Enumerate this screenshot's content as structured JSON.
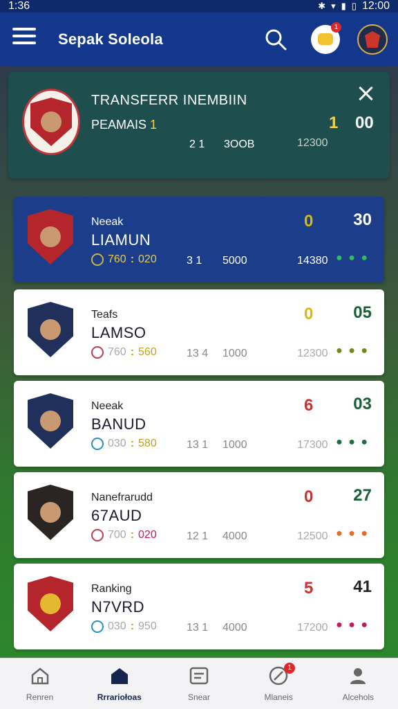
{
  "status_bar": {
    "time": "1:36",
    "time_right": "12:00"
  },
  "header": {
    "title": "Sepak Soleola"
  },
  "badges": {
    "chat_count": "1",
    "nav_badge": "1"
  },
  "featured": {
    "title": "TRANSFERR INEMBIIN",
    "subtitle_label": "PEAMAIS",
    "subtitle_num": "1",
    "meta_a": "2 1",
    "meta_b": "3OOB",
    "num_left": "1",
    "num_right": "00",
    "num_meta": "12300"
  },
  "cards": [
    {
      "kicker": "Neeak",
      "name": "LIAMUN",
      "stat_left": "760",
      "stat_sep": ":",
      "stat_right": "020",
      "mid_a": "3 1",
      "mid_b": "5000",
      "pin": "0",
      "pin_color": "yellow",
      "score": "30",
      "sub": "14380",
      "dots": "● ● ●",
      "dots_color": "#1b8e4a"
    },
    {
      "kicker": "Teafs",
      "name": "LAMSO",
      "stat_left": "760",
      "stat_sep": ":",
      "stat_right": "560",
      "mid_a": "13 4",
      "mid_b": "1000",
      "pin": "0",
      "pin_color": "yellow",
      "score": "05",
      "sub": "12300",
      "dots": "● ● ●",
      "dots_color": "#6e8a12"
    },
    {
      "kicker": "Neeak",
      "name": "BANUD",
      "stat_left": "030",
      "stat_sep": ":",
      "stat_right": "580",
      "mid_a": "13 1",
      "mid_b": "1000",
      "pin": "6",
      "pin_color": "red",
      "score": "03",
      "sub": "17300",
      "dots": "● ● ●",
      "dots_color": "#1b6e3f"
    },
    {
      "kicker": "Nanefrarudd",
      "name": "67AUD",
      "stat_left": "700",
      "stat_sep": ":",
      "stat_right": "020",
      "mid_a": "12 1",
      "mid_b": "4000",
      "pin": "0",
      "pin_color": "red",
      "score": "27",
      "sub": "12500",
      "dots": "● ● ●",
      "dots_color": "#e86a1a"
    },
    {
      "kicker": "Ranking",
      "name": "N7VRD",
      "stat_left": "030",
      "stat_sep": ":",
      "stat_right": "950",
      "mid_a": "13 1",
      "mid_b": "4000",
      "pin": "5",
      "pin_color": "red",
      "score": "41",
      "sub": "17200",
      "dots": "● ● ●",
      "dots_color": "#c2195f"
    }
  ],
  "bottom_nav": [
    {
      "label": "Renren",
      "icon": "home-icon",
      "active": false
    },
    {
      "label": "Rrrariołoas",
      "icon": "stadium-icon",
      "active": true
    },
    {
      "label": "Snear",
      "icon": "card-icon",
      "active": false
    },
    {
      "label": "Mlaneis",
      "icon": "compass-icon",
      "active": false,
      "badge": "1"
    },
    {
      "label": "Alcehols",
      "icon": "user-icon",
      "active": false
    }
  ]
}
